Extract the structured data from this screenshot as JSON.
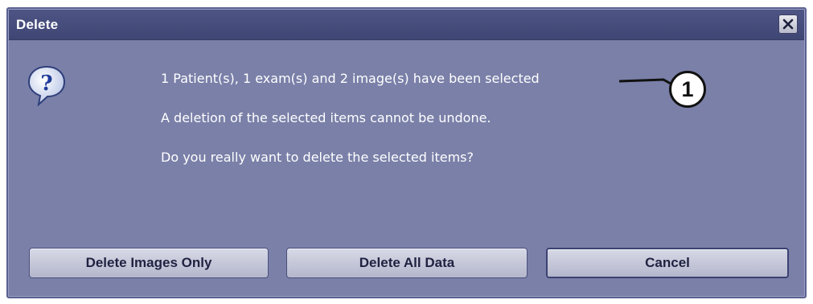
{
  "dialog": {
    "title": "Delete",
    "close_icon": "close-x-icon",
    "question_icon": "question-bubble-icon",
    "messages": [
      "1 Patient(s), 1 exam(s) and 2 image(s) have been selected",
      "A deletion of the selected items cannot be undone.",
      "Do you really want to delete the selected items?"
    ],
    "callout_label": "1",
    "buttons": {
      "delete_images_only": "Delete Images Only",
      "delete_all_data": "Delete All Data",
      "cancel": "Cancel"
    }
  },
  "colors": {
    "dialog_body": "#7a80a8",
    "titlebar": "#3f4674",
    "button_face": "#c6c8d9",
    "text": "#ffffff"
  }
}
